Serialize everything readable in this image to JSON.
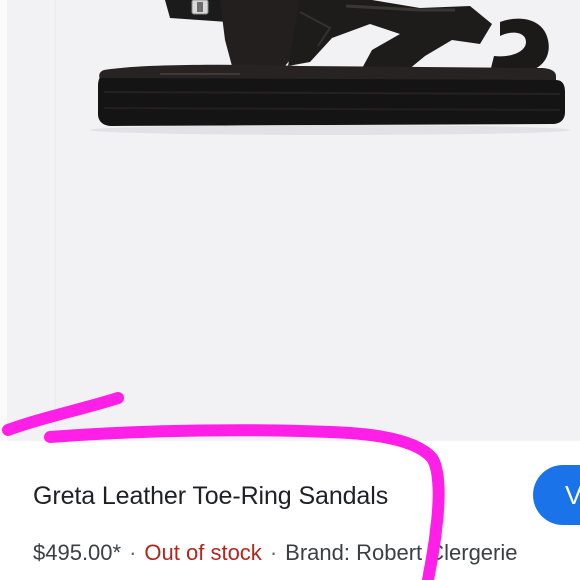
{
  "product": {
    "title": "Greta Leather Toe-Ring Sandals",
    "price": "$495.00*",
    "separator": "·",
    "stock_status": "Out of stock",
    "brand_label": "Brand:",
    "brand_name": "Robert Clergerie"
  },
  "action_button": {
    "label": "V"
  },
  "colors": {
    "image_background": "#f2f2f4",
    "sandal_black": "#1c1b1b",
    "out_of_stock": "#b3261e",
    "button_blue": "#1a73e8",
    "annotation_magenta": "#ff1fe6"
  },
  "icons": {
    "product_photo": "sandal-image",
    "annotation": "magenta-scribble"
  }
}
